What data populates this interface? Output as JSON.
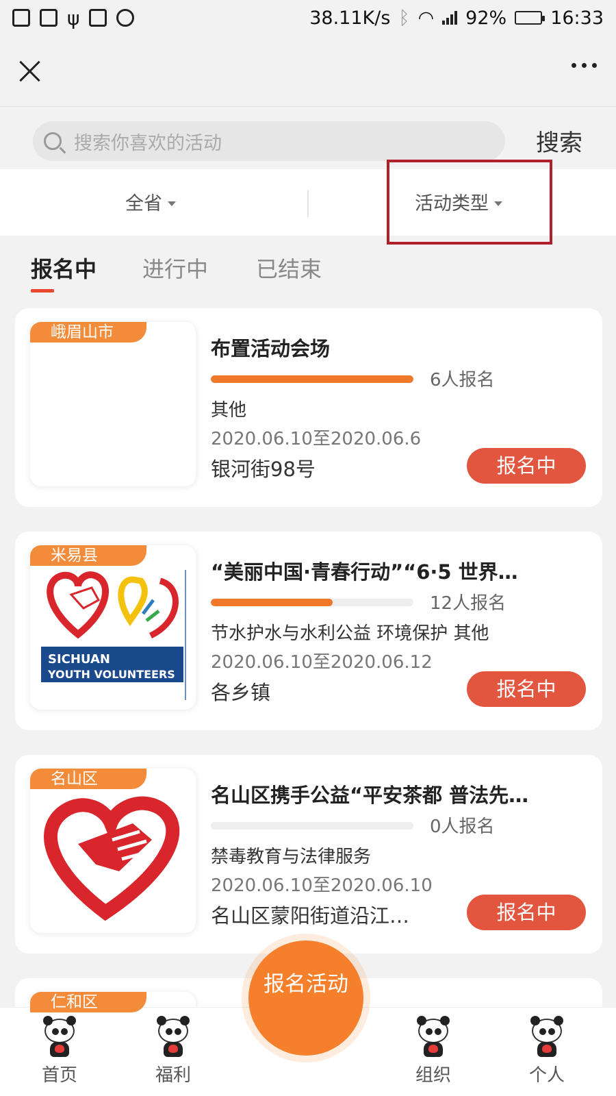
{
  "status_bar": {
    "net_speed": "38.11K/s",
    "battery": "92%",
    "battery_level": 0.92,
    "time": "16:33"
  },
  "search": {
    "placeholder": "搜索你喜欢的活动",
    "button": "搜索"
  },
  "filters": {
    "region": "全省",
    "type": "活动类型"
  },
  "tabs": [
    "报名中",
    "进行中",
    "已结束"
  ],
  "cards": [
    {
      "region": "峨眉山市",
      "title": "布置活动会场",
      "progress": 1.0,
      "signups": "6人报名",
      "category": "其他",
      "dates": "2020.06.10至2020.06.6",
      "place": "银河街98号",
      "status": "报名中",
      "logo_text": ""
    },
    {
      "region": "米易县",
      "title": "“美丽中国·青春行动”“6·5 世界…",
      "progress": 0.6,
      "signups": "12人报名",
      "category": "节水护水与水利公益 环境保护 其他",
      "dates": "2020.06.10至2020.06.12",
      "place": "各乡镇",
      "status": "报名中",
      "logo_text": [
        "SICHUAN",
        "YOUTH VOLUNTEERS"
      ]
    },
    {
      "region": "名山区",
      "title": "名山区携手公益“平安茶都 普法先…",
      "progress": 0.0,
      "signups": "0人报名",
      "category": "禁毒教育与法律服务",
      "dates": "2020.06.10至2020.06.10",
      "place": "名山区蒙阳街道沿江…",
      "status": "报名中",
      "logo_text": ""
    }
  ],
  "partial_card": {
    "region": "仁和区"
  },
  "fab_label": "报名活动",
  "bottom_nav": [
    "首页",
    "福利",
    "组织",
    "个人"
  ],
  "colors": {
    "accent": "#f57f2a",
    "status_button": "#e2553f",
    "highlight_box": "#b0202a",
    "tab_indicator": "#e8462d"
  }
}
